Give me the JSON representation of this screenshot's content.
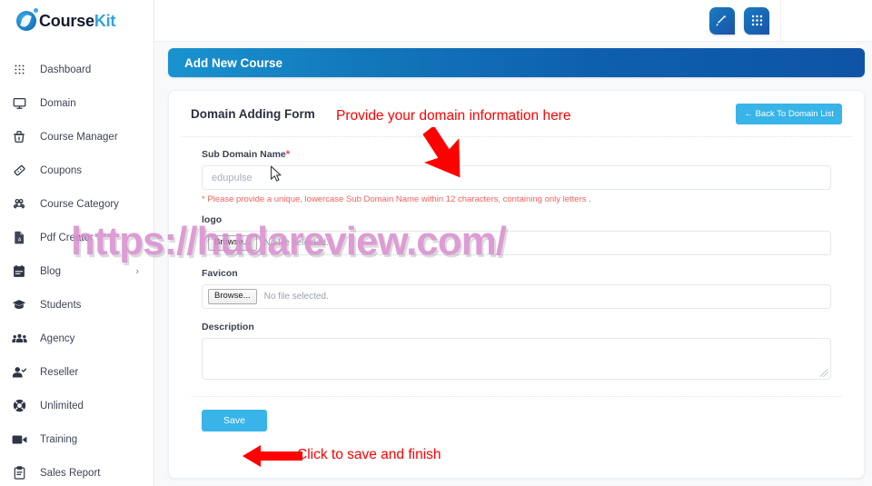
{
  "brand": {
    "name_part1": "Course",
    "name_part2": "Kit",
    "icon": "rocket-circle-logo"
  },
  "sidebar": {
    "items": [
      {
        "label": "Dashboard",
        "icon": "grid-dots-icon",
        "caret": ""
      },
      {
        "label": "Domain",
        "icon": "monitor-icon",
        "caret": ""
      },
      {
        "label": "Course Manager",
        "icon": "basket-icon",
        "caret": ""
      },
      {
        "label": "Coupons",
        "icon": "ticket-icon",
        "caret": ""
      },
      {
        "label": "Course Category",
        "icon": "command-icon",
        "caret": ""
      },
      {
        "label": "Pdf Creator",
        "icon": "pdf-file-icon",
        "caret": ""
      },
      {
        "label": "Blog",
        "icon": "calendar-icon",
        "caret": "›"
      },
      {
        "label": "Students",
        "icon": "graduation-cap-icon",
        "caret": ""
      },
      {
        "label": "Agency",
        "icon": "users-group-icon",
        "caret": ""
      },
      {
        "label": "Reseller",
        "icon": "user-check-icon",
        "caret": ""
      },
      {
        "label": "Unlimited",
        "icon": "lifebuoy-icon",
        "caret": ""
      },
      {
        "label": "Training",
        "icon": "video-camera-icon",
        "caret": ""
      },
      {
        "label": "Sales Report",
        "icon": "clipboard-icon",
        "caret": ""
      }
    ]
  },
  "topbar": {
    "buttons": [
      {
        "icon": "magic-wand-icon",
        "label": ""
      },
      {
        "icon": "app-grid-icon",
        "label": ""
      }
    ]
  },
  "page": {
    "banner_title": "Add New Course"
  },
  "form": {
    "title": "Domain Adding Form",
    "back_button": "← Back To Domain List",
    "sub_domain": {
      "label": "Sub Domain Name",
      "required_mark": "*",
      "value": "",
      "placeholder": "edupulse",
      "hint": "* Please provide a unique, lowercase Sub Domain Name within 12 characters, containing only letters ."
    },
    "logo": {
      "label": "logo",
      "browse_label": "Browse...",
      "file_status": "No file selected."
    },
    "favicon": {
      "label": "Favicon",
      "browse_label": "Browse...",
      "file_status": "No file selected."
    },
    "description": {
      "label": "Description",
      "value": "",
      "placeholder": ""
    },
    "save_button": "Save"
  },
  "annotations": {
    "top_text": "Provide your domain information here",
    "bottom_text": "Click to save and finish",
    "color": "#ff0000"
  },
  "watermark": {
    "text": "https://hudareview.com/",
    "color": "#d98fd0"
  },
  "colors": {
    "banner_start": "#1a93cf",
    "banner_end": "#0f54a6",
    "accent_blue": "#38b4e8",
    "hint_red": "#f2635c",
    "brand_blue": "#2fa3e0",
    "brand_dark": "#151b2c"
  }
}
